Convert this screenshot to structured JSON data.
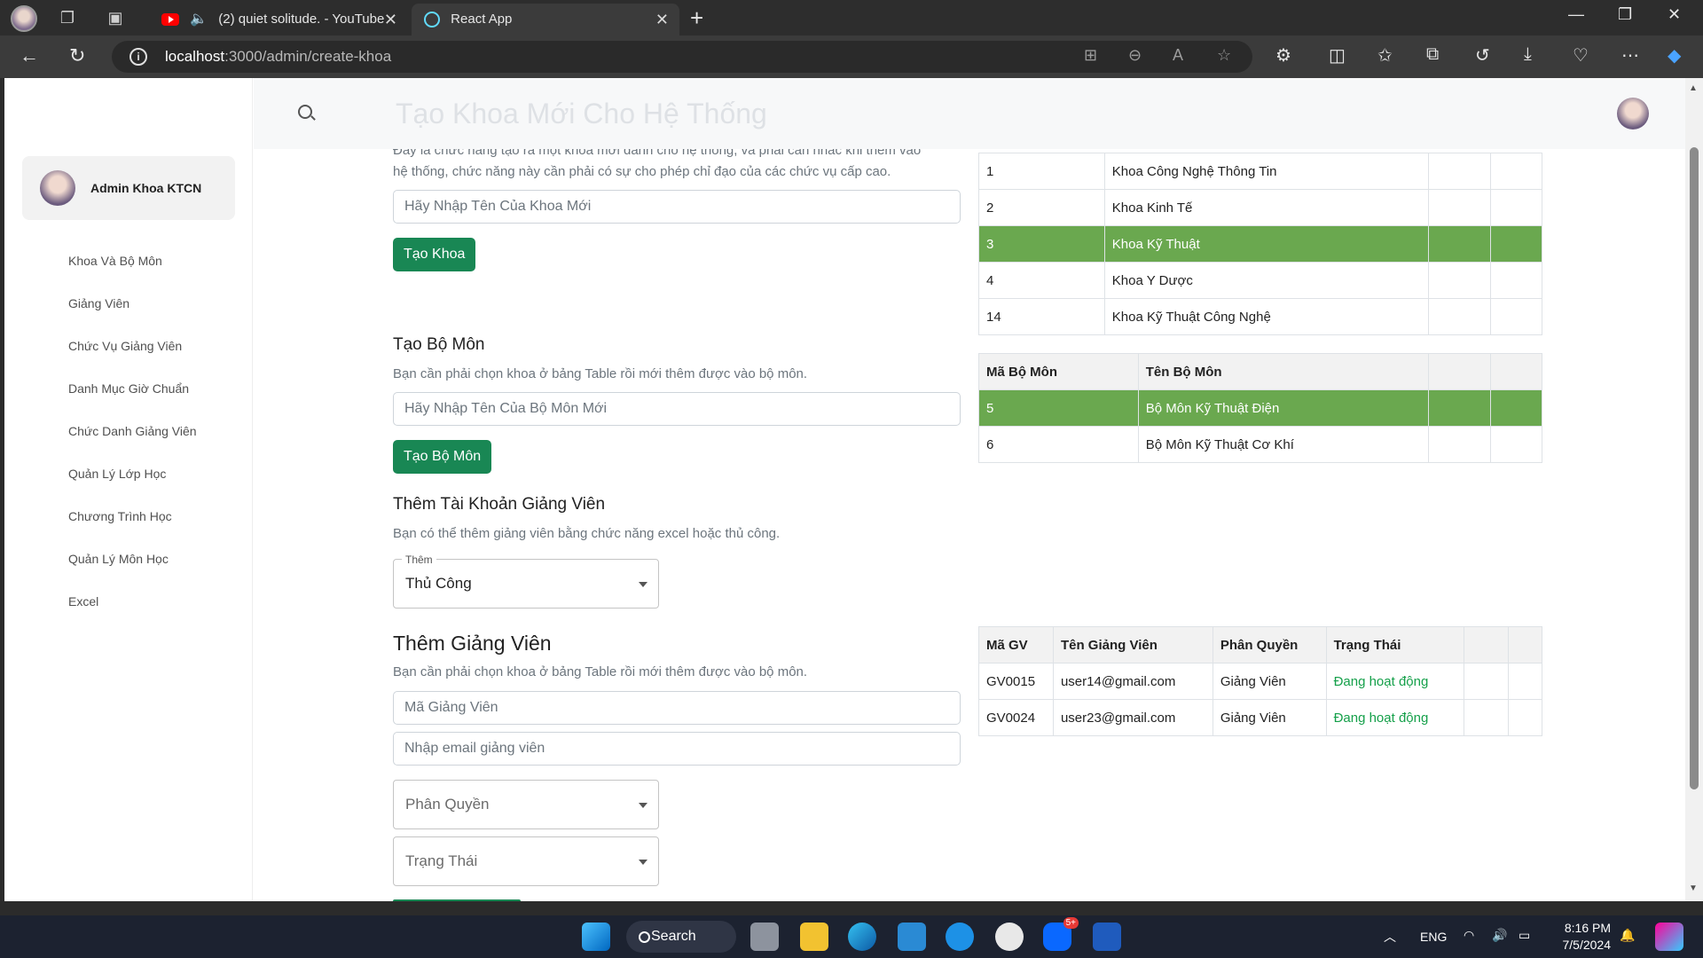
{
  "browser": {
    "tabs": [
      {
        "title": "(2) quiet solitude. - YouTube"
      },
      {
        "title": "React App"
      }
    ],
    "url_host": "localhost",
    "url_path": ":3000/admin/create-khoa"
  },
  "sidebar": {
    "admin_name": "Admin Khoa KTCN",
    "items": [
      {
        "label": "Khoa Và Bộ Môn"
      },
      {
        "label": "Giảng Viên"
      },
      {
        "label": "Chức Vụ Giảng Viên"
      },
      {
        "label": "Danh Mục Giờ Chuẩn"
      },
      {
        "label": "Chức Danh Giảng Viên"
      },
      {
        "label": "Quản Lý Lớp Học"
      },
      {
        "label": "Chương Trình Học"
      },
      {
        "label": "Quản Lý Môn Học"
      },
      {
        "label": "Excel"
      }
    ]
  },
  "header": {
    "title": "Tạo Khoa Mới Cho Hệ Thống"
  },
  "create_khoa": {
    "desc_line1": "Đây là chức năng tạo ra một khoa mới dành cho hệ thống, và phải cân nhắc khi thêm vào",
    "desc_line2": "hệ thống, chức năng này cần phải có sự cho phép chỉ đạo của các chức vụ cấp cao.",
    "placeholder": "Hãy Nhập Tên Của Khoa Mới",
    "button": "Tạo Khoa"
  },
  "create_bomon": {
    "title": "Tạo Bộ Môn",
    "desc": "Bạn cần phải chọn khoa ở bảng Table rồi mới thêm được vào bộ môn.",
    "placeholder": "Hãy Nhập Tên Của Bộ Môn Mới",
    "button": "Tạo Bộ Môn"
  },
  "add_account": {
    "title": "Thêm Tài Khoản Giảng Viên",
    "desc": "Bạn có thể thêm giảng viên bằng chức năng excel hoặc thủ công.",
    "select_label": "Thêm",
    "select_value": "Thủ Công"
  },
  "add_lecturer": {
    "title": "Thêm Giảng Viên",
    "desc": "Bạn cần phải chọn khoa ở bảng Table rồi mới thêm được vào bộ môn.",
    "code_placeholder": "Mã Giảng Viên",
    "email_placeholder": "Nhập email giảng viên",
    "role_placeholder": "Phân Quyền",
    "status_placeholder": "Trạng Thái"
  },
  "khoa_table": {
    "rows": [
      {
        "id": "1",
        "name": "Khoa Công Nghệ Thông Tin",
        "selected": false
      },
      {
        "id": "2",
        "name": "Khoa Kinh Tế",
        "selected": false
      },
      {
        "id": "3",
        "name": "Khoa Kỹ Thuật",
        "selected": true
      },
      {
        "id": "4",
        "name": "Khoa Y Dược",
        "selected": false
      },
      {
        "id": "14",
        "name": "Khoa Kỹ Thuật Công Nghệ",
        "selected": false
      }
    ]
  },
  "bomon_table": {
    "headers": [
      "Mã Bộ Môn",
      "Tên Bộ Môn"
    ],
    "rows": [
      {
        "id": "5",
        "name": "Bộ Môn Kỹ Thuật Điện",
        "selected": true
      },
      {
        "id": "6",
        "name": "Bộ Môn Kỹ Thuật Cơ Khí",
        "selected": false
      }
    ]
  },
  "gv_table": {
    "headers": [
      "Mã GV",
      "Tên Giảng Viên",
      "Phân Quyền",
      "Trạng Thái"
    ],
    "rows": [
      {
        "code": "GV0015",
        "email": "user14@gmail.com",
        "role": "Giảng Viên",
        "status": "Đang hoạt động"
      },
      {
        "code": "GV0024",
        "email": "user23@gmail.com",
        "role": "Giảng Viên",
        "status": "Đang hoạt động"
      }
    ]
  },
  "taskbar": {
    "search_label": "Search",
    "language": "ENG",
    "time": "8:16 PM",
    "date": "7/5/2024",
    "zalo_badge": "5+"
  },
  "colors": {
    "selected_row": "#6aa84f",
    "button_green": "#198754",
    "status_active": "#15a04a"
  }
}
